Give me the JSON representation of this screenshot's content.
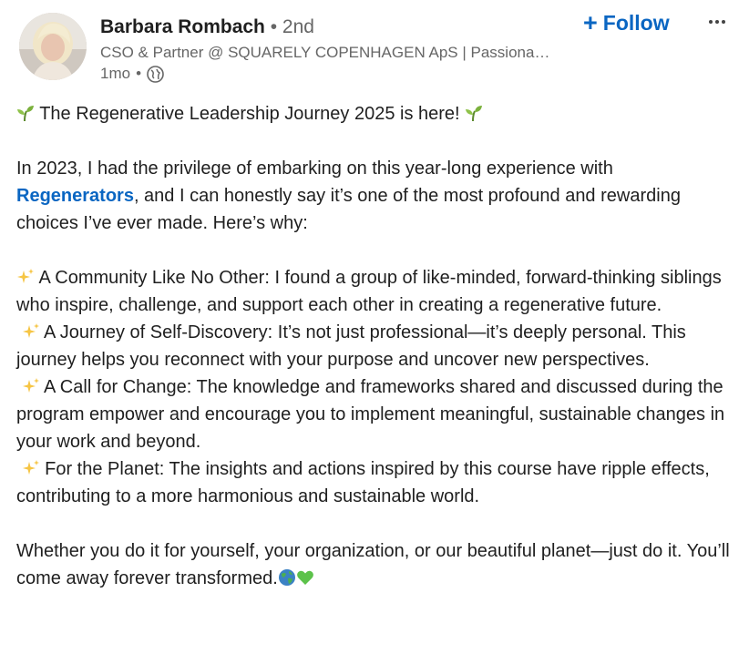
{
  "author": {
    "name": "Barbara Rombach",
    "degree": "• 2nd",
    "headline": "CSO & Partner @ SQUARELY COPENHAGEN ApS | Passiona…",
    "time": "1mo",
    "sep": "•",
    "visibility_icon": "globe-icon"
  },
  "actions": {
    "follow_plus": "+",
    "follow_label": "Follow",
    "more_icon": "more-options-icon"
  },
  "post": {
    "title": " The Regenerative Leadership Journey 2025 is here! ",
    "intro_before_link": "In 2023, I had the privilege of embarking on this year-long experience with ",
    "intro_link": "Regenerators",
    "intro_after_link": ", and I can honestly say it’s one of the most profound and rewarding choices I’ve ever made. Here’s why:",
    "point1": " A Community Like No Other: I found a group of like-minded, forward-thinking siblings who inspire, challenge, and support each other in creating a regenerative future.",
    "point2": " A Journey of Self-Discovery: It’s not just professional—it’s deeply personal. This journey helps you reconnect with your purpose and uncover new perspectives.",
    "point3": " A Call for Change: The knowledge and frameworks shared and discussed during the program empower and encourage you to implement meaningful, sustainable changes in your work and beyond.",
    "point4": " For the Planet: The insights and actions inspired by this course have ripple effects, contributing to a more harmonious and sustainable world.",
    "closing": "Whether you do it for yourself, your organization, or our beautiful planet—just do it. You’ll come away forever transformed."
  },
  "colors": {
    "accent": "#0a66c2",
    "text": "#1f1f1f",
    "muted": "#666666"
  }
}
